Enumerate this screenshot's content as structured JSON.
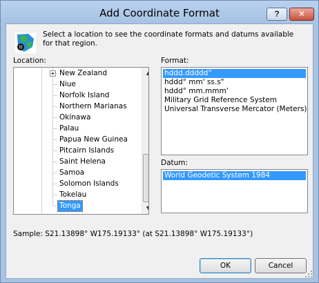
{
  "window": {
    "title": "Add Coordinate Format",
    "help_label": "?",
    "close_label": "✕"
  },
  "intro_text": "Select a location to see the coordinate formats and datums available for that region.",
  "location": {
    "label": "Location:",
    "items": [
      {
        "label": "New Zealand",
        "expandable": true
      },
      {
        "label": "Niue"
      },
      {
        "label": "Norfolk Island"
      },
      {
        "label": "Northern Marianas"
      },
      {
        "label": "Okinawa"
      },
      {
        "label": "Palau"
      },
      {
        "label": "Papua New Guinea"
      },
      {
        "label": "Pitcairn Islands"
      },
      {
        "label": "Saint Helena"
      },
      {
        "label": "Samoa"
      },
      {
        "label": "Solomon Islands"
      },
      {
        "label": "Tokelau"
      },
      {
        "label": "Tonga",
        "selected": true
      }
    ]
  },
  "format": {
    "label": "Format:",
    "items": [
      {
        "label": "hddd.ddddd°",
        "selected": true
      },
      {
        "label": "hddd° mm' ss.s\""
      },
      {
        "label": "hddd° mm.mmm'"
      },
      {
        "label": "Military Grid Reference System"
      },
      {
        "label": "Universal Transverse Mercator (Meters)"
      }
    ]
  },
  "datum": {
    "label": "Datum:",
    "items": [
      {
        "label": "World Geodetic System 1984",
        "selected": true
      }
    ]
  },
  "sample_text": "Sample: S21.13898°  W175.19133° (at S21.13898°  W175.19133°)",
  "buttons": {
    "ok": "OK",
    "cancel": "Cancel"
  },
  "colors": {
    "selection": "#3399ff",
    "frame": "#a9c3e3"
  }
}
